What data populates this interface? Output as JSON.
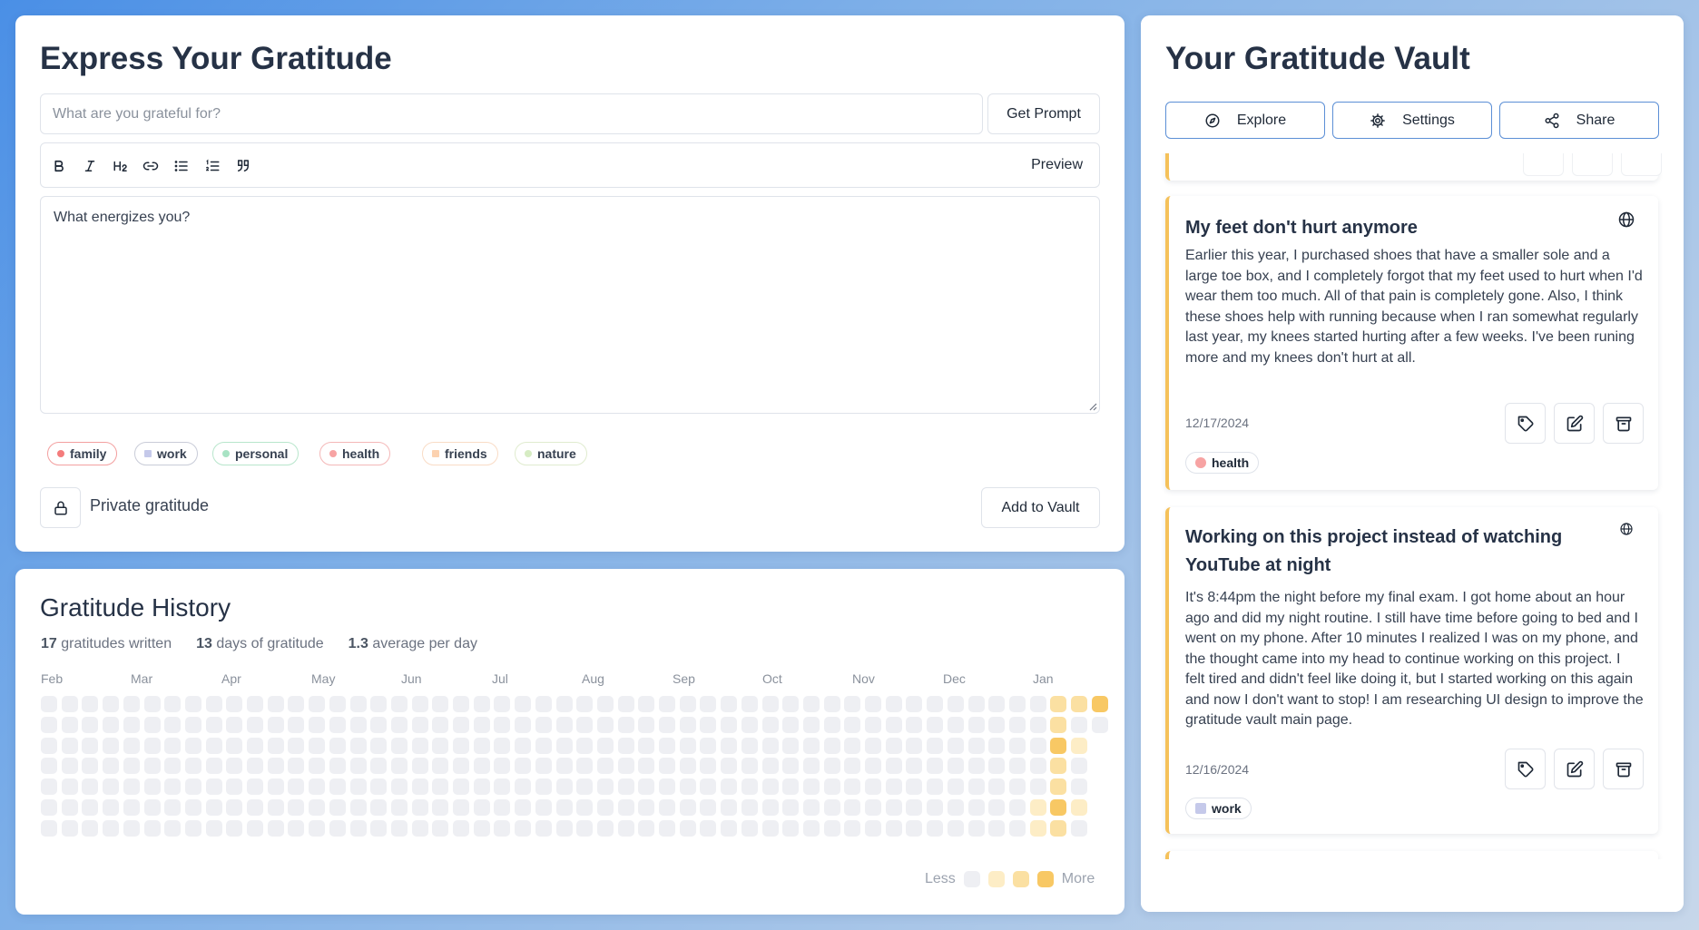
{
  "express": {
    "title": "Express Your Gratitude",
    "input_placeholder": "What are you grateful for?",
    "get_prompt_label": "Get Prompt",
    "preview_label": "Preview",
    "editor_text": "What energizes you?",
    "tags": [
      {
        "label": "family",
        "color": "#f47c7c",
        "border": "#f3a0a0"
      },
      {
        "label": "work",
        "color": "#c5c9ea",
        "border": "#c9ccd8"
      },
      {
        "label": "personal",
        "color": "#a8e3c4",
        "border": "#b8e6cc"
      },
      {
        "label": "health",
        "color": "#f7a3a3",
        "border": "#f4b8b8"
      },
      {
        "label": "friends",
        "color": "#fcd2b0",
        "border": "#f9dcc6"
      },
      {
        "label": "nature",
        "color": "#d6ecc3",
        "border": "#e0eccf"
      }
    ],
    "private_label": "Private gratitude",
    "add_label": "Add to Vault"
  },
  "history": {
    "title": "Gratitude History",
    "stats": [
      {
        "value": "17",
        "label": "gratitudes written"
      },
      {
        "value": "13",
        "label": "days of gratitude"
      },
      {
        "value": "1.3",
        "label": "average per day"
      }
    ],
    "months": [
      "Feb",
      "Mar",
      "Apr",
      "May",
      "Jun",
      "Jul",
      "Aug",
      "Sep",
      "Oct",
      "Nov",
      "Dec",
      "Jan"
    ],
    "legend_less": "Less",
    "legend_more": "More",
    "colors": {
      "empty": "#eeeff3",
      "l1": "#fdedc6",
      "l2": "#fbe0a2",
      "l3": "#f8c864",
      "l4": "#f5b53a"
    },
    "active_cells": [
      {
        "week": 49,
        "day": 0,
        "level": 2
      },
      {
        "week": 50,
        "day": 0,
        "level": 2
      },
      {
        "week": 51,
        "day": 0,
        "level": 3
      },
      {
        "week": 49,
        "day": 1,
        "level": 2
      },
      {
        "week": 49,
        "day": 2,
        "level": 3
      },
      {
        "week": 50,
        "day": 2,
        "level": 1
      },
      {
        "week": 49,
        "day": 3,
        "level": 2
      },
      {
        "week": 49,
        "day": 4,
        "level": 2
      },
      {
        "week": 48,
        "day": 5,
        "level": 1
      },
      {
        "week": 49,
        "day": 5,
        "level": 3
      },
      {
        "week": 50,
        "day": 5,
        "level": 1
      },
      {
        "week": 48,
        "day": 6,
        "level": 1
      },
      {
        "week": 49,
        "day": 6,
        "level": 2
      }
    ]
  },
  "vault": {
    "title": "Your Gratitude Vault",
    "buttons": [
      "Explore",
      "Settings",
      "Share"
    ],
    "entries": [
      {
        "title": "My feet don't hurt anymore",
        "body": "Earlier this year, I purchased shoes that have a smaller sole and a large toe box, and I completely forgot that my feet used to hurt when I'd wear them too much. All of that pain is completely gone. Also, I think these shoes help with running because when I ran somewhat regularly last year, my knees started hurting after a few weeks. I've been runing more and my knees don't hurt at all.",
        "date": "12/17/2024",
        "tag": "health",
        "tag_color": "#f7a3a3"
      },
      {
        "title": "Working on this project instead of watching YouTube at night",
        "body": "It's 8:44pm the night before my final exam. I got home about an hour ago and did my night routine. I still have time before going to bed and I went on my phone. After 10 minutes I realized I was on my phone, and the thought came into my head to continue working on this project. I felt tired and didn't feel like doing it, but I started working on this again and now I don't want to stop! I am researching UI design to improve the gratitude vault main page.",
        "date": "12/16/2024",
        "tag": "work",
        "tag_color": "#c5c9ea"
      }
    ]
  }
}
